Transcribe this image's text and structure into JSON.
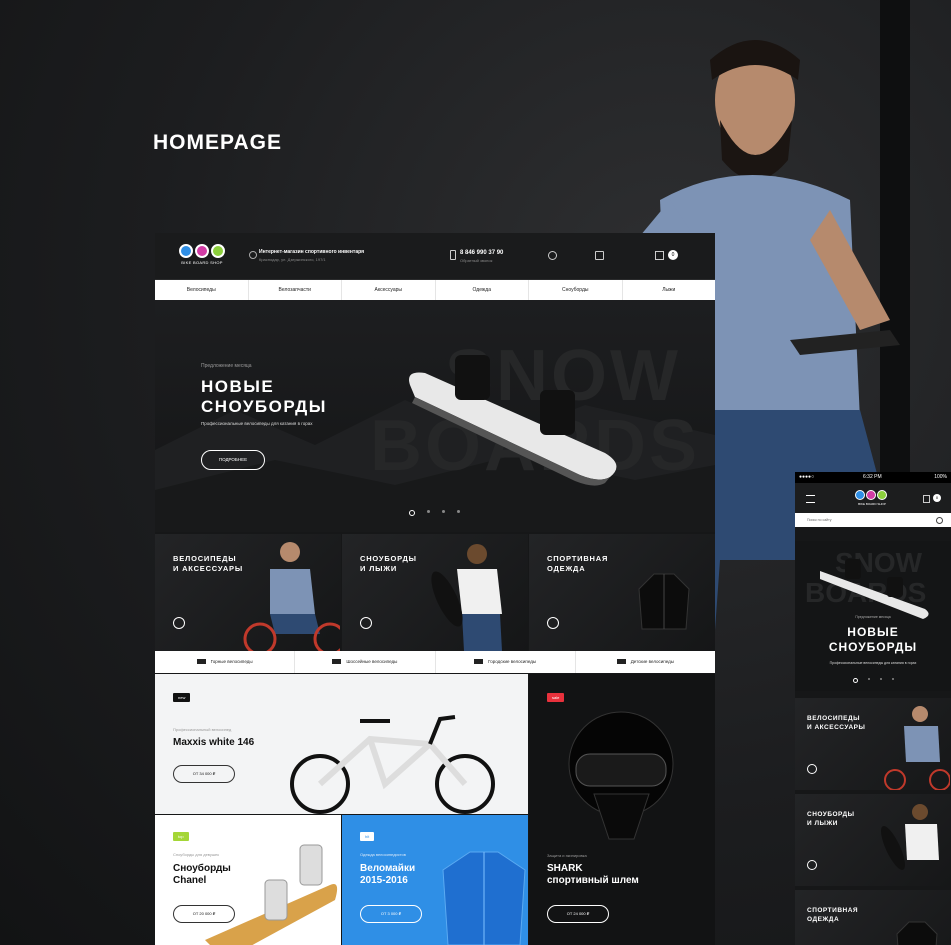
{
  "page_label": "HOMEPAGE",
  "site": {
    "logo_text": "BIKE BOARD SHOP",
    "address_line1": "Интернет-магазин спортивного инвентаря",
    "address_line2": "Краснодар, ул. Дзержинского, 197/1",
    "phone": "8 846 990 37 90",
    "callback": "Обратный звонок",
    "cart_count": "0"
  },
  "nav": [
    "Велосипеды",
    "Велозапчасти",
    "Аксессуары",
    "Одежда",
    "Сноуборды",
    "Лыжи"
  ],
  "slider": {
    "bg_word1": "SNOW",
    "bg_word2": "BOARDS",
    "kicker": "Предложение месяца",
    "title": "НОВЫЕ СНОУБОРДЫ",
    "subtitle": "Профессиональные велосипеды для катания в горах",
    "button": "ПОДРОБНЕЕ"
  },
  "categories": [
    {
      "title": "ВЕЛОСИПЕДЫ\nИ АКСЕССУАРЫ"
    },
    {
      "title": "СНОУБОРДЫ\nИ ЛЫЖИ"
    },
    {
      "title": "СПОРТИВНАЯ\nОДЕЖДА"
    }
  ],
  "subnav": [
    "Горные велосипеды",
    "Шоссейные велосипеды",
    "Городские велосипеды",
    "Детские велосипеды"
  ],
  "products": {
    "bike": {
      "badge": "new",
      "kicker": "Профессиональный велосипед",
      "name": "Maxxis white 146",
      "price": "ОТ 34 000 ₽"
    },
    "helmet": {
      "badge": "sale",
      "kicker": "Защита и экипировка",
      "name": "SHARK\nспортивный шлем",
      "price": "ОТ 24 000 ₽"
    },
    "board": {
      "badge": "top",
      "kicker": "Сноуборды для девушек",
      "name": "Сноуборды\nChanel",
      "price": "ОТ 20 000 ₽"
    },
    "jersey": {
      "badge": "hit",
      "kicker": "Одежда велосипедистов",
      "name": "Веломайки\n2015-2016",
      "price": "ОТ 3 000 ₽"
    }
  },
  "mobile": {
    "carrier": "●●●●○",
    "time": "6:32 PM",
    "battery": "100%",
    "search_placeholder": "Поиск по сайту",
    "bg_word1": "SNOW",
    "bg_word2": "BOARDS",
    "kicker": "Предложение месяца",
    "title": "НОВЫЕ СНОУБОРДЫ",
    "subtitle": "Профессиональные велосипеды для катания в горах",
    "categories": [
      "ВЕЛОСИПЕДЫ\nИ АКСЕССУАРЫ",
      "СНОУБОРДЫ\nИ ЛЫЖИ",
      "СПОРТИВНАЯ\nОДЕЖДА"
    ]
  },
  "colors": {
    "badge_new": "#111111",
    "badge_sale": "#e8313c",
    "badge_top": "#a4d636",
    "badge_hit": "#ffffff",
    "jersey_bg": "#2f8fe6"
  }
}
